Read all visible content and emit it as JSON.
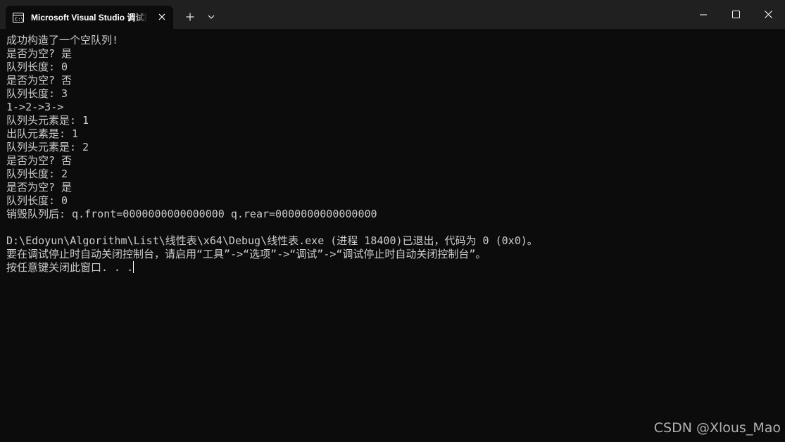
{
  "tab": {
    "title": "Microsoft Visual Studio 调试控制台",
    "icon": "console-app-icon"
  },
  "titlebar": {
    "new_tab_icon": "plus-icon",
    "dropdown_icon": "chevron-down-icon",
    "window_controls": [
      "minimize-icon",
      "maximize-icon",
      "close-icon"
    ]
  },
  "console": {
    "lines": [
      "成功构造了一个空队列!",
      "是否为空? 是",
      "队列长度: 0",
      "是否为空? 否",
      "队列长度: 3",
      "1->2->3->",
      "队列头元素是: 1",
      "出队元素是: 1",
      "队列头元素是: 2",
      "是否为空? 否",
      "队列长度: 2",
      "是否为空? 是",
      "队列长度: 0",
      "销毁队列后: q.front=0000000000000000 q.rear=0000000000000000",
      "",
      "D:\\Edoyun\\Algorithm\\List\\线性表\\x64\\Debug\\线性表.exe (进程 18400)已退出，代码为 0 (0x0)。",
      "要在调试停止时自动关闭控制台，请启用“工具”->“选项”->“调试”->“调试停止时自动关闭控制台”。",
      "按任意键关闭此窗口. . ."
    ]
  },
  "watermark": "CSDN @Xlous_Mao",
  "colors": {
    "titlebar_bg": "#202020",
    "console_bg": "#0c0c0c",
    "console_text": "#cccccc"
  }
}
